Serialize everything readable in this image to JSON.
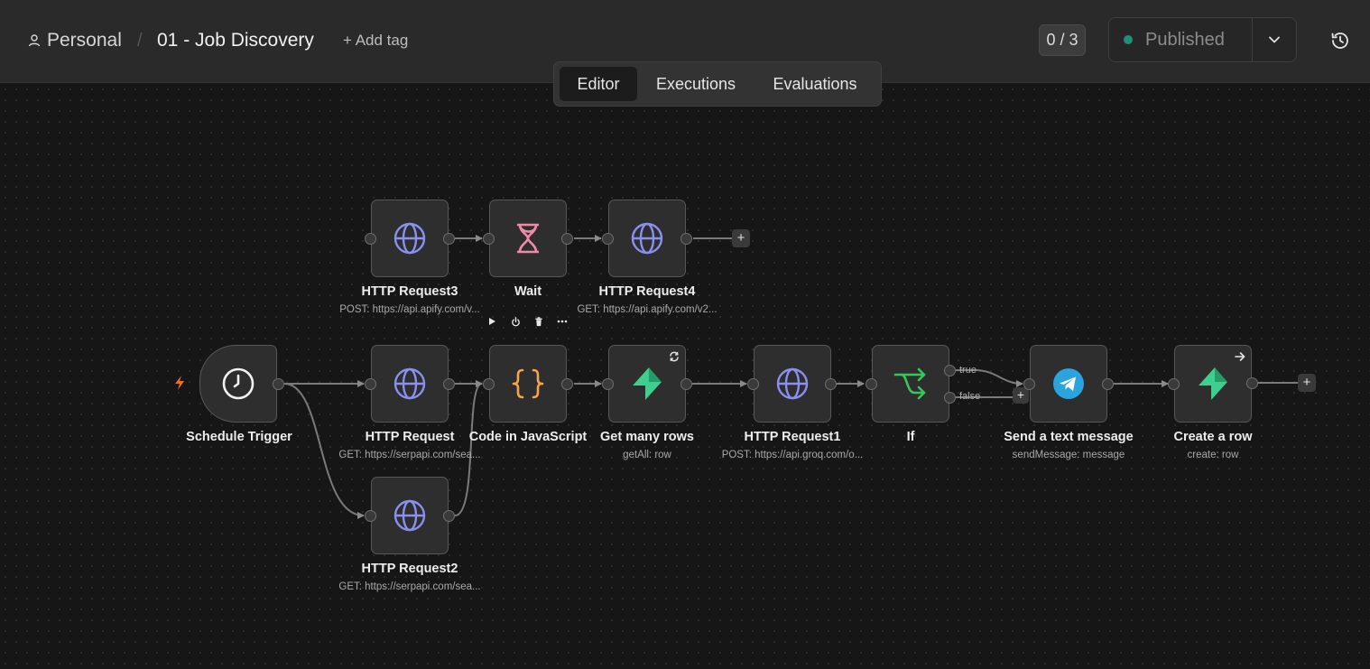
{
  "header": {
    "breadcrumb_project": "Personal",
    "breadcrumb_separator": "/",
    "workflow_title": "01 - Job Discovery",
    "add_tag_label": "+ Add tag",
    "counter": "0 / 3",
    "publish_status": "Published"
  },
  "tabs": [
    {
      "label": "Editor",
      "active": true
    },
    {
      "label": "Executions",
      "active": false
    },
    {
      "label": "Evaluations",
      "active": false
    }
  ],
  "nodes": {
    "http_request3": {
      "title": "HTTP Request3",
      "subtitle": "POST: https://api.apify.com/v..."
    },
    "wait": {
      "title": "Wait",
      "subtitle": ""
    },
    "http_request4": {
      "title": "HTTP Request4",
      "subtitle": "GET: https://api.apify.com/v2..."
    },
    "schedule_trigger": {
      "title": "Schedule Trigger",
      "subtitle": ""
    },
    "http_request": {
      "title": "HTTP Request",
      "subtitle": "GET: https://serpapi.com/sea..."
    },
    "code_js": {
      "title": "Code in JavaScript",
      "subtitle": ""
    },
    "get_many_rows": {
      "title": "Get many rows",
      "subtitle": "getAll: row"
    },
    "http_request1": {
      "title": "HTTP Request1",
      "subtitle": "POST: https://api.groq.com/o..."
    },
    "if_node": {
      "title": "If",
      "subtitle": ""
    },
    "send_text": {
      "title": "Send a text message",
      "subtitle": "sendMessage: message"
    },
    "create_row": {
      "title": "Create a row",
      "subtitle": "create: row"
    },
    "http_request2": {
      "title": "HTTP Request2",
      "subtitle": "GET: https://serpapi.com/sea..."
    }
  },
  "branches": {
    "true_label": "true",
    "false_label": "false"
  },
  "plus_label": "+",
  "colors": {
    "http_icon": "#8b8ff0",
    "wait_icon": "#f08aa8",
    "code_icon": "#f5a64a",
    "supabase_icon": "#3ecf8e",
    "if_icon": "#35c759",
    "telegram": "#2aa3df",
    "trigger_bolt": "#f26b23",
    "published_dot": "#1f8f7a"
  },
  "icons": {
    "http": "globe-icon",
    "wait": "hourglass-icon",
    "trigger": "clock-icon",
    "code": "braces-icon",
    "supabase": "lightning-icon",
    "if": "branch-arrows-icon",
    "telegram": "paper-plane-icon"
  }
}
